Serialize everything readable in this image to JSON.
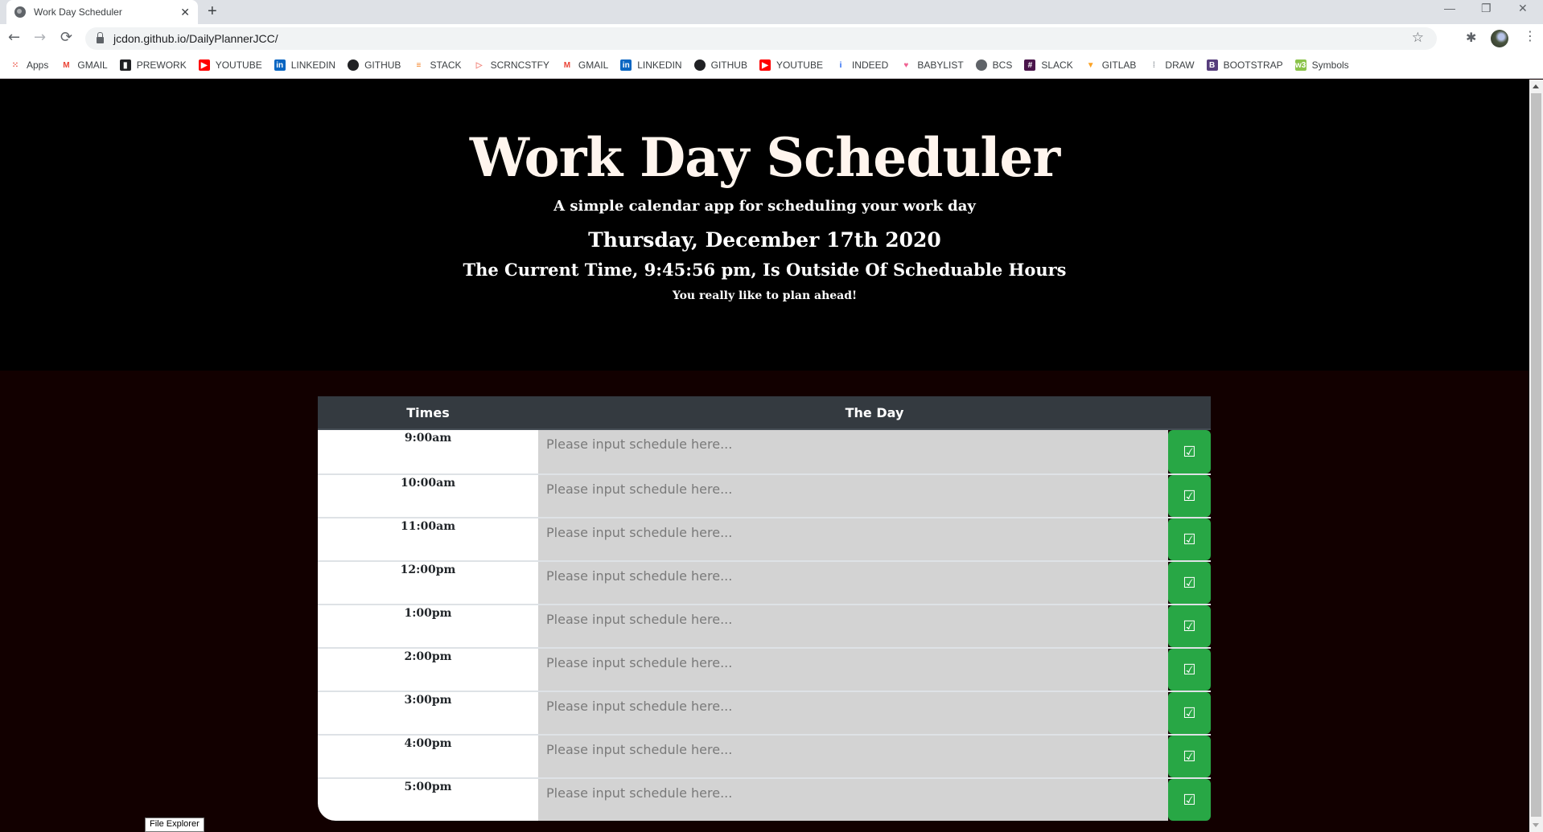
{
  "browser": {
    "tab_title": "Work Day Scheduler",
    "new_tab": "+",
    "url": "jcdon.github.io/DailyPlannerJCC/",
    "window_controls": {
      "minimize": "—",
      "restore": "❐",
      "close": "✕"
    },
    "nav": {
      "back": "←",
      "forward": "→",
      "reload": "⟳"
    },
    "bookmarks": [
      {
        "label": "Apps",
        "icon": "apps-grid-icon",
        "glyph": "⁙",
        "color": "#ea4335"
      },
      {
        "label": "GMAIL",
        "icon": "gmail-icon",
        "glyph": "M",
        "color": "#ea4335"
      },
      {
        "label": "PREWORK",
        "icon": "book-icon",
        "glyph": "▮",
        "color": "#202124"
      },
      {
        "label": "YOUTUBE",
        "icon": "youtube-icon",
        "glyph": "▶",
        "color": "#ff0000"
      },
      {
        "label": "LINKEDIN",
        "icon": "linkedin-icon",
        "glyph": "in",
        "color": "#0a66c2"
      },
      {
        "label": "GITHUB",
        "icon": "github-icon",
        "glyph": "●",
        "color": "#202124"
      },
      {
        "label": "STACK",
        "icon": "stackoverflow-icon",
        "glyph": "≡",
        "color": "#f48024"
      },
      {
        "label": "SCRNCSTFY",
        "icon": "screencastify-icon",
        "glyph": "▷",
        "color": "#f28b82"
      },
      {
        "label": "GMAIL",
        "icon": "gmail-icon",
        "glyph": "M",
        "color": "#ea4335"
      },
      {
        "label": "LINKEDIN",
        "icon": "linkedin-icon",
        "glyph": "in",
        "color": "#0a66c2"
      },
      {
        "label": "GITHUB",
        "icon": "github-icon",
        "glyph": "●",
        "color": "#202124"
      },
      {
        "label": "YOUTUBE",
        "icon": "youtube-icon",
        "glyph": "▶",
        "color": "#ff0000"
      },
      {
        "label": "INDEED",
        "icon": "indeed-icon",
        "glyph": "i",
        "color": "#2164f3"
      },
      {
        "label": "BABYLIST",
        "icon": "heart-icon",
        "glyph": "♥",
        "color": "#f06292"
      },
      {
        "label": "BCS",
        "icon": "globe-icon",
        "glyph": "●",
        "color": "#5f6368"
      },
      {
        "label": "SLACK",
        "icon": "slack-icon",
        "glyph": "#",
        "color": "#4a154b"
      },
      {
        "label": "GITLAB",
        "icon": "gitlab-icon",
        "glyph": "▼",
        "color": "#fca326"
      },
      {
        "label": "DRAW",
        "icon": "draw-icon",
        "glyph": "⁞",
        "color": "#9aa0a6"
      },
      {
        "label": "BOOTSTRAP",
        "icon": "bootstrap-icon",
        "glyph": "B",
        "color": "#563d7c"
      },
      {
        "label": "Symbols",
        "icon": "w3-icon",
        "glyph": "w3",
        "color": "#8bc34a"
      }
    ]
  },
  "header": {
    "title": "Work Day Scheduler",
    "lead": "A simple calendar app for scheduling your work day",
    "date": "Thursday, December 17th 2020",
    "current_time_message": "The Current Time, 9:45:56 pm, Is Outside Of Scheduable Hours",
    "note": "You really like to plan ahead!"
  },
  "planner": {
    "columns": {
      "times": "Times",
      "day": "The Day"
    },
    "placeholder": "Please input schedule here...",
    "save_glyph": "☑",
    "rows": [
      {
        "time": "9:00am",
        "value": ""
      },
      {
        "time": "10:00am",
        "value": ""
      },
      {
        "time": "11:00am",
        "value": ""
      },
      {
        "time": "12:00pm",
        "value": ""
      },
      {
        "time": "1:00pm",
        "value": ""
      },
      {
        "time": "2:00pm",
        "value": ""
      },
      {
        "time": "3:00pm",
        "value": ""
      },
      {
        "time": "4:00pm",
        "value": ""
      },
      {
        "time": "5:00pm",
        "value": ""
      }
    ]
  },
  "colors": {
    "save_green": "#28a745",
    "header_dark": "#343a40",
    "page_bg": "#120000",
    "input_bg": "#d3d3d3"
  },
  "tooltip": "File Explorer"
}
